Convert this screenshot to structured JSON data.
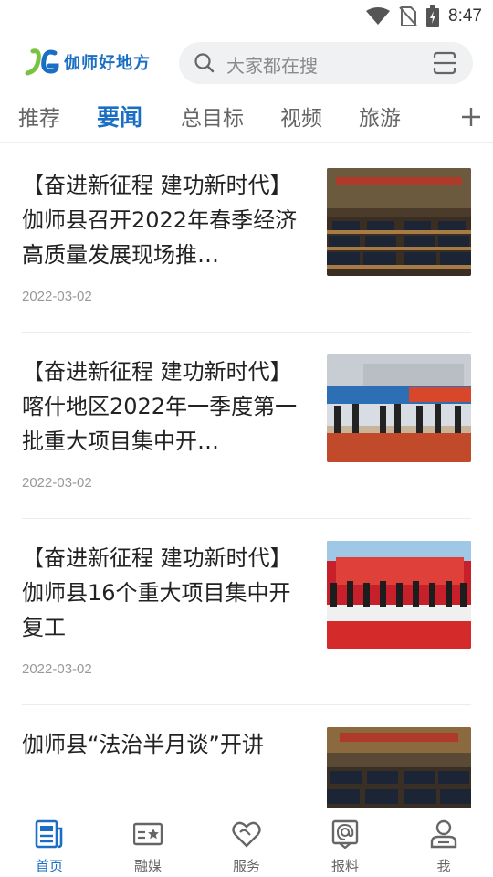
{
  "status_bar": {
    "time": "8:47"
  },
  "header": {
    "logo_text": "伽师好地方",
    "search_placeholder": "大家都在搜"
  },
  "tabs": [
    {
      "label": "推荐",
      "active": false
    },
    {
      "label": "要闻",
      "active": true
    },
    {
      "label": "总目标",
      "active": false
    },
    {
      "label": "视频",
      "active": false
    },
    {
      "label": "旅游",
      "active": false
    }
  ],
  "news": [
    {
      "title": "【奋进新征程 建功新时代】伽师县召开2022年春季经济高质量发展现场推…",
      "date": "2022-03-02",
      "thumb_icon": "meeting-hall-photo"
    },
    {
      "title": "【奋进新征程 建功新时代】喀什地区2022年一季度第一批重大项目集中开…",
      "date": "2022-03-02",
      "thumb_icon": "outdoor-ceremony-photo"
    },
    {
      "title": "【奋进新征程 建功新时代】伽师县16个重大项目集中开复工",
      "date": "2022-03-02",
      "thumb_icon": "red-stage-ceremony-photo"
    },
    {
      "title": "伽师县“法治半月谈”开讲",
      "date": "",
      "thumb_icon": "meeting-hall-photo"
    }
  ],
  "bottom_nav": [
    {
      "label": "首页",
      "icon": "news-icon",
      "active": true
    },
    {
      "label": "融媒",
      "icon": "media-card-icon",
      "active": false
    },
    {
      "label": "服务",
      "icon": "heart-service-icon",
      "active": false
    },
    {
      "label": "报料",
      "icon": "report-at-icon",
      "active": false
    },
    {
      "label": "我",
      "icon": "profile-icon",
      "active": false
    }
  ],
  "colors": {
    "accent": "#1a6fc4",
    "text": "#222222",
    "muted": "#999999"
  }
}
